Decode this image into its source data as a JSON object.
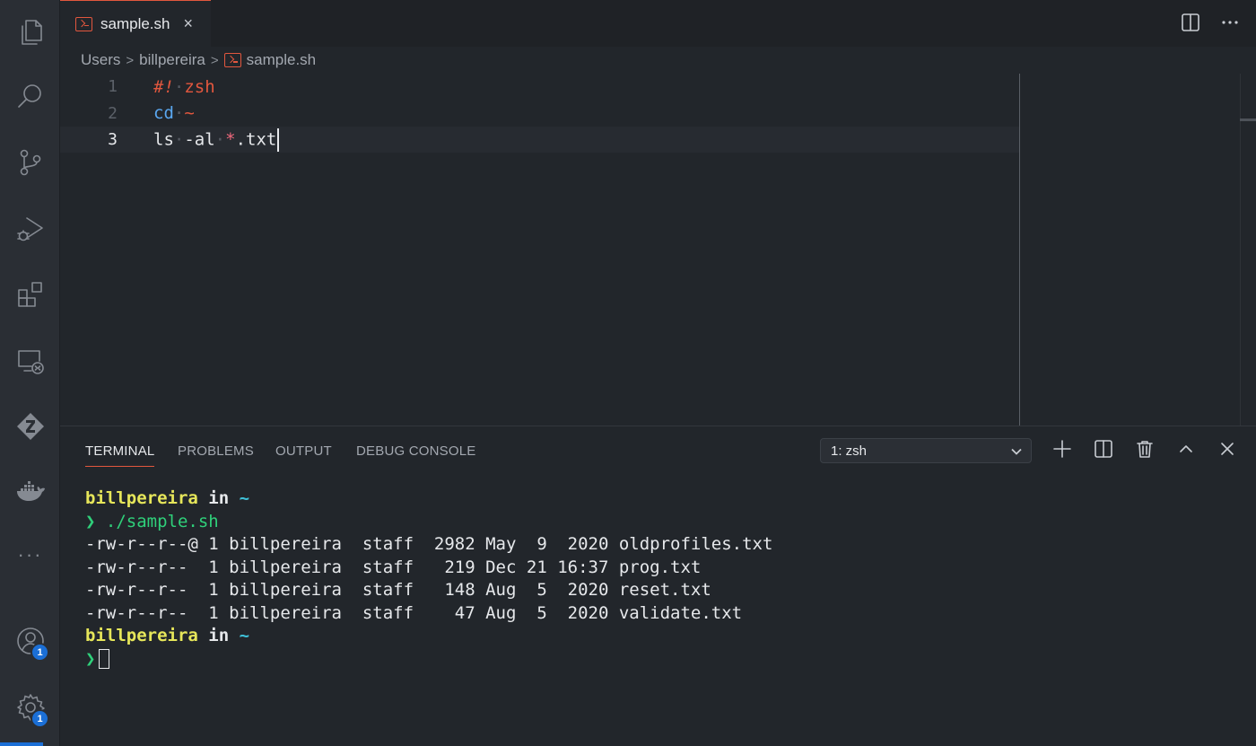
{
  "tab": {
    "title": "sample.sh",
    "close": "×"
  },
  "breadcrumb": [
    "Users",
    "billpereira",
    "sample.sh"
  ],
  "editor": {
    "lines": [
      {
        "number": "1",
        "parts": [
          [
            "#!",
            "hash"
          ],
          [
            "·",
            "dot"
          ],
          [
            "zsh",
            "red"
          ]
        ]
      },
      {
        "number": "2",
        "parts": [
          [
            "cd",
            "blue"
          ],
          [
            "·",
            "dot"
          ],
          [
            "~",
            "red"
          ]
        ]
      },
      {
        "number": "3",
        "parts": [
          [
            "ls",
            "white"
          ],
          [
            "·",
            "dot"
          ],
          [
            "-al",
            "white"
          ],
          [
            "·",
            "dot"
          ],
          [
            "*",
            "star"
          ],
          [
            ".txt",
            "white"
          ]
        ]
      }
    ],
    "active_line": 3
  },
  "panel": {
    "tabs": [
      "TERMINAL",
      "PROBLEMS",
      "OUTPUT",
      "DEBUG CONSOLE"
    ],
    "active_tab": "TERMINAL",
    "terminal_select": "1: zsh"
  },
  "terminal": {
    "user": "billpereira",
    "in": "in",
    "dir": "~",
    "prompt": "❯",
    "command": "./sample.sh",
    "output": [
      "-rw-r--r--@ 1 billpereira  staff  2982 May  9  2020 oldprofiles.txt",
      "-rw-r--r--  1 billpereira  staff   219 Dec 21 16:37 prog.txt",
      "-rw-r--r--  1 billpereira  staff   148 Aug  5  2020 reset.txt",
      "-rw-r--r--  1 billpereira  staff    47 Aug  5  2020 validate.txt"
    ]
  },
  "activity": {
    "accounts_badge": "1",
    "settings_badge": "1",
    "more": "···"
  },
  "colors": {
    "accent": "#e2573e",
    "badge": "#1b6fd6",
    "prompt": "#2fd07a",
    "user": "#e6e65a"
  }
}
